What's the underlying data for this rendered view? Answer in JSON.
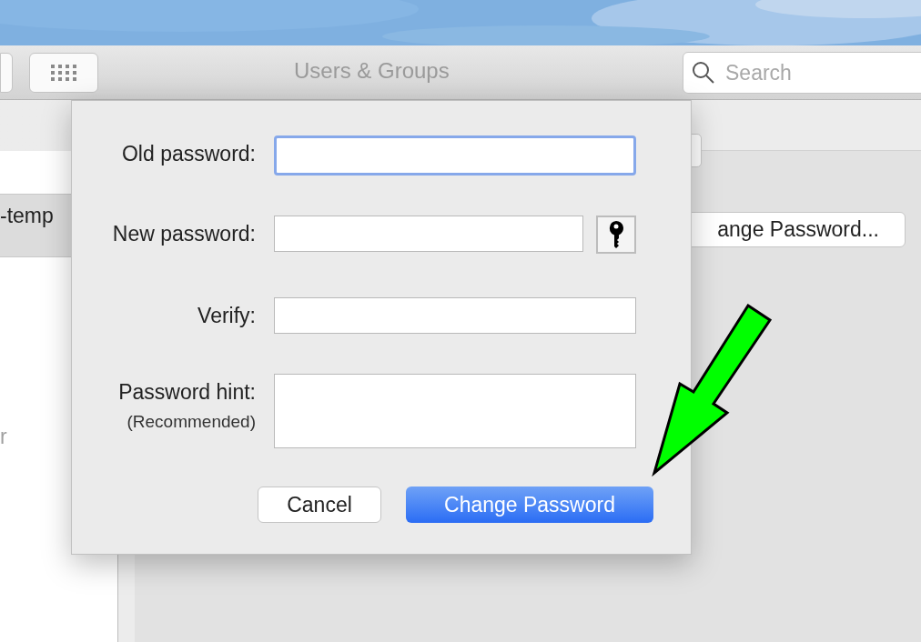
{
  "window": {
    "title": "Users & Groups"
  },
  "search": {
    "placeholder": "Search"
  },
  "sidebar": {
    "items": [
      {
        "label": "-temp",
        "selected": true
      },
      {
        "label": "r",
        "selected": false
      }
    ]
  },
  "background_button": {
    "label": "ange Password..."
  },
  "dialog": {
    "fields": [
      {
        "label": "Old password:",
        "kind": "single",
        "focused": true
      },
      {
        "label": "New password:",
        "kind": "with-key",
        "focused": false
      },
      {
        "label": "Verify:",
        "kind": "single",
        "focused": false
      },
      {
        "label": "Password hint:",
        "sublabel": "(Recommended)",
        "kind": "multi",
        "focused": false
      }
    ],
    "buttons": [
      {
        "label": "Cancel",
        "kind": "secondary"
      },
      {
        "label": "Change Password",
        "kind": "primary"
      }
    ]
  }
}
